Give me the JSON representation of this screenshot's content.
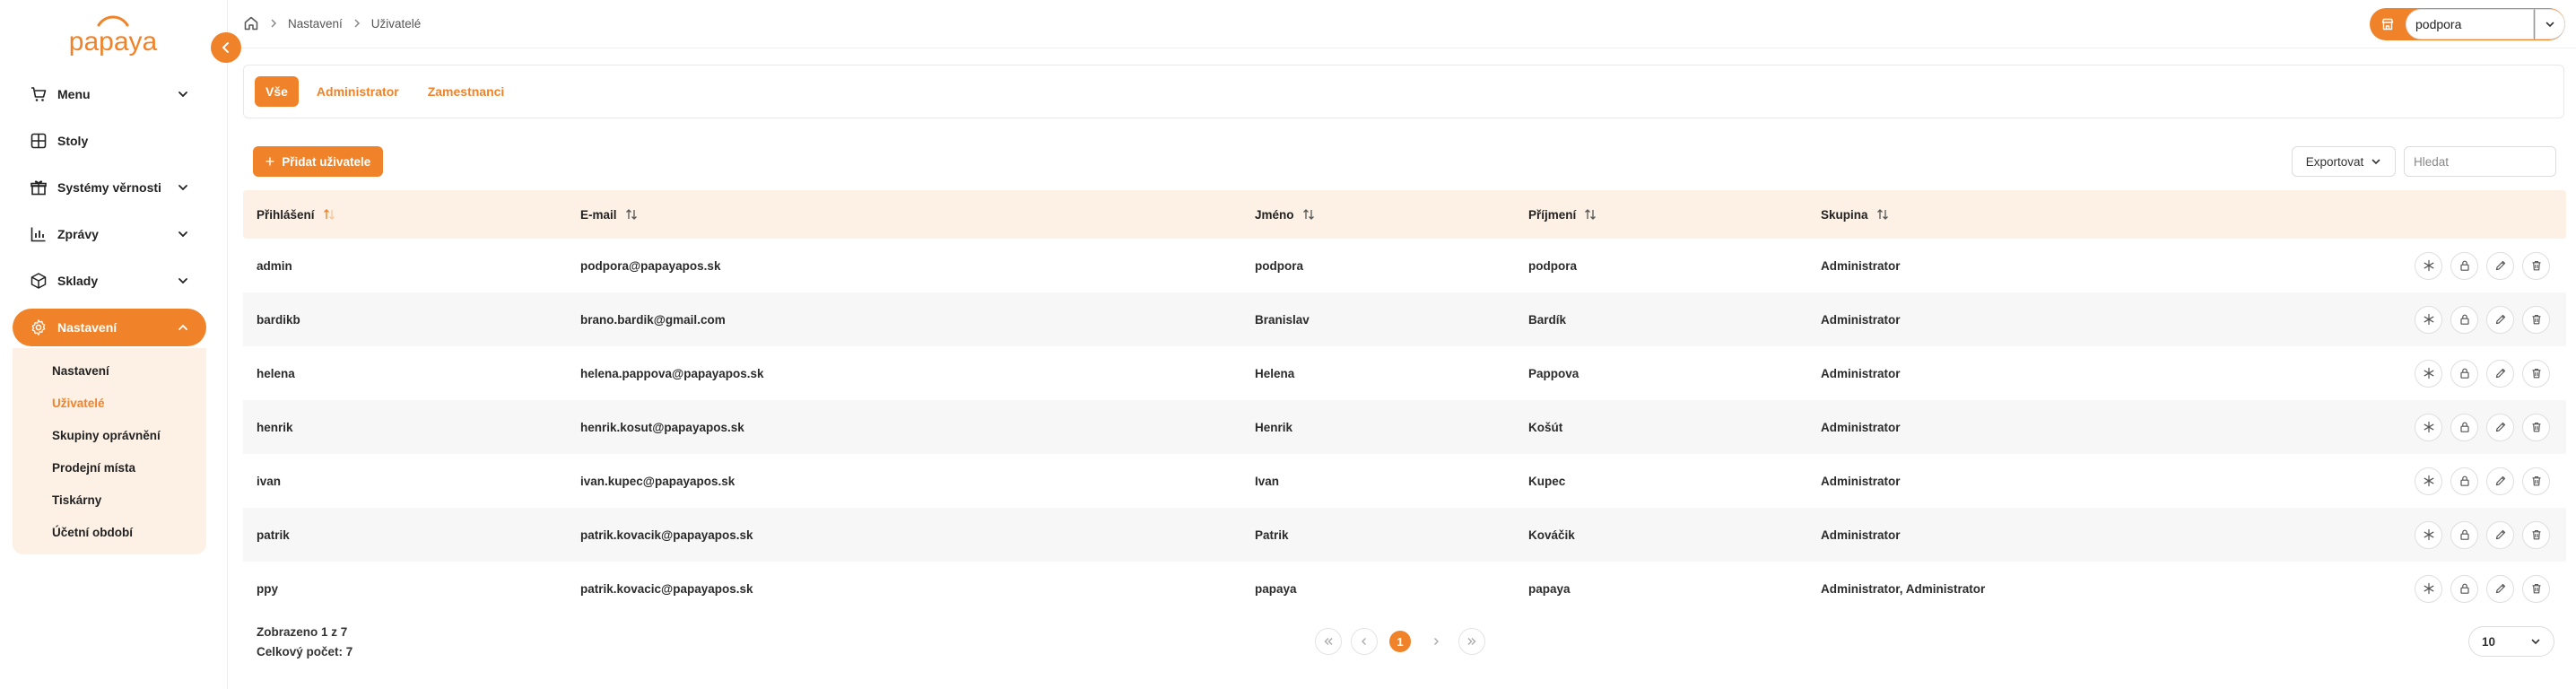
{
  "brand": {
    "logo_text": "papaya",
    "accent": "#f0832a",
    "accent_soft": "#fdf1e6"
  },
  "sidebar": {
    "items": [
      {
        "label": "Menu",
        "icon": "cart-icon",
        "expandable": true
      },
      {
        "label": "Stoly",
        "icon": "table-grid-icon",
        "expandable": false
      },
      {
        "label": "Systémy věrnosti",
        "icon": "gift-icon",
        "expandable": true
      },
      {
        "label": "Zprávy",
        "icon": "bar-chart-icon",
        "expandable": true
      },
      {
        "label": "Sklady",
        "icon": "box-icon",
        "expandable": true
      },
      {
        "label": "Nastavení",
        "icon": "gear-icon",
        "expandable": true,
        "active": true
      }
    ],
    "submenu": [
      {
        "label": "Nastavení"
      },
      {
        "label": "Uživatelé",
        "active": true
      },
      {
        "label": "Skupiny oprávnění"
      },
      {
        "label": "Prodejní místa"
      },
      {
        "label": "Tiskárny"
      },
      {
        "label": "Účetní období"
      }
    ]
  },
  "breadcrumb": {
    "home_icon": "home-icon",
    "items": [
      "Nastavení",
      "Uživatelé"
    ]
  },
  "user_select": {
    "value": "podpora",
    "icon": "store-icon"
  },
  "tabs": [
    {
      "label": "Vše",
      "active": true
    },
    {
      "label": "Administrator"
    },
    {
      "label": "Zamestnanci"
    }
  ],
  "toolbar": {
    "add_label": "Přidat uživatele",
    "export_label": "Exportovat",
    "search_placeholder": "Hledat"
  },
  "table": {
    "columns": [
      "Přihlášení",
      "E-mail",
      "Jméno",
      "Příjmení",
      "Skupina"
    ],
    "rows": [
      [
        "admin",
        "podpora@papayapos.sk",
        "podpora",
        "podpora",
        "Administrator"
      ],
      [
        "bardikb",
        "brano.bardik@gmail.com",
        "Branislav",
        "Bardík",
        "Administrator"
      ],
      [
        "helena",
        "helena.pappova@papayapos.sk",
        "Helena",
        "Pappova",
        "Administrator"
      ],
      [
        "henrik",
        "henrik.kosut@papayapos.sk",
        "Henrik",
        "Košút",
        "Administrator"
      ],
      [
        "ivan",
        "ivan.kupec@papayapos.sk",
        "Ivan",
        "Kupec",
        "Administrator"
      ],
      [
        "patrik",
        "patrik.kovacik@papayapos.sk",
        "Patrik",
        "Kováčik",
        "Administrator"
      ],
      [
        "ppy",
        "patrik.kovacic@papayapos.sk",
        "papaya",
        "papaya",
        "Administrator, Administrator"
      ]
    ],
    "row_actions": [
      "asterisk-icon",
      "lock-icon",
      "pencil-icon",
      "trash-icon"
    ]
  },
  "footer": {
    "shown": "Zobrazeno 1 z 7",
    "total": "Celkový počet: 7",
    "current_page": "1",
    "page_size": "10"
  }
}
